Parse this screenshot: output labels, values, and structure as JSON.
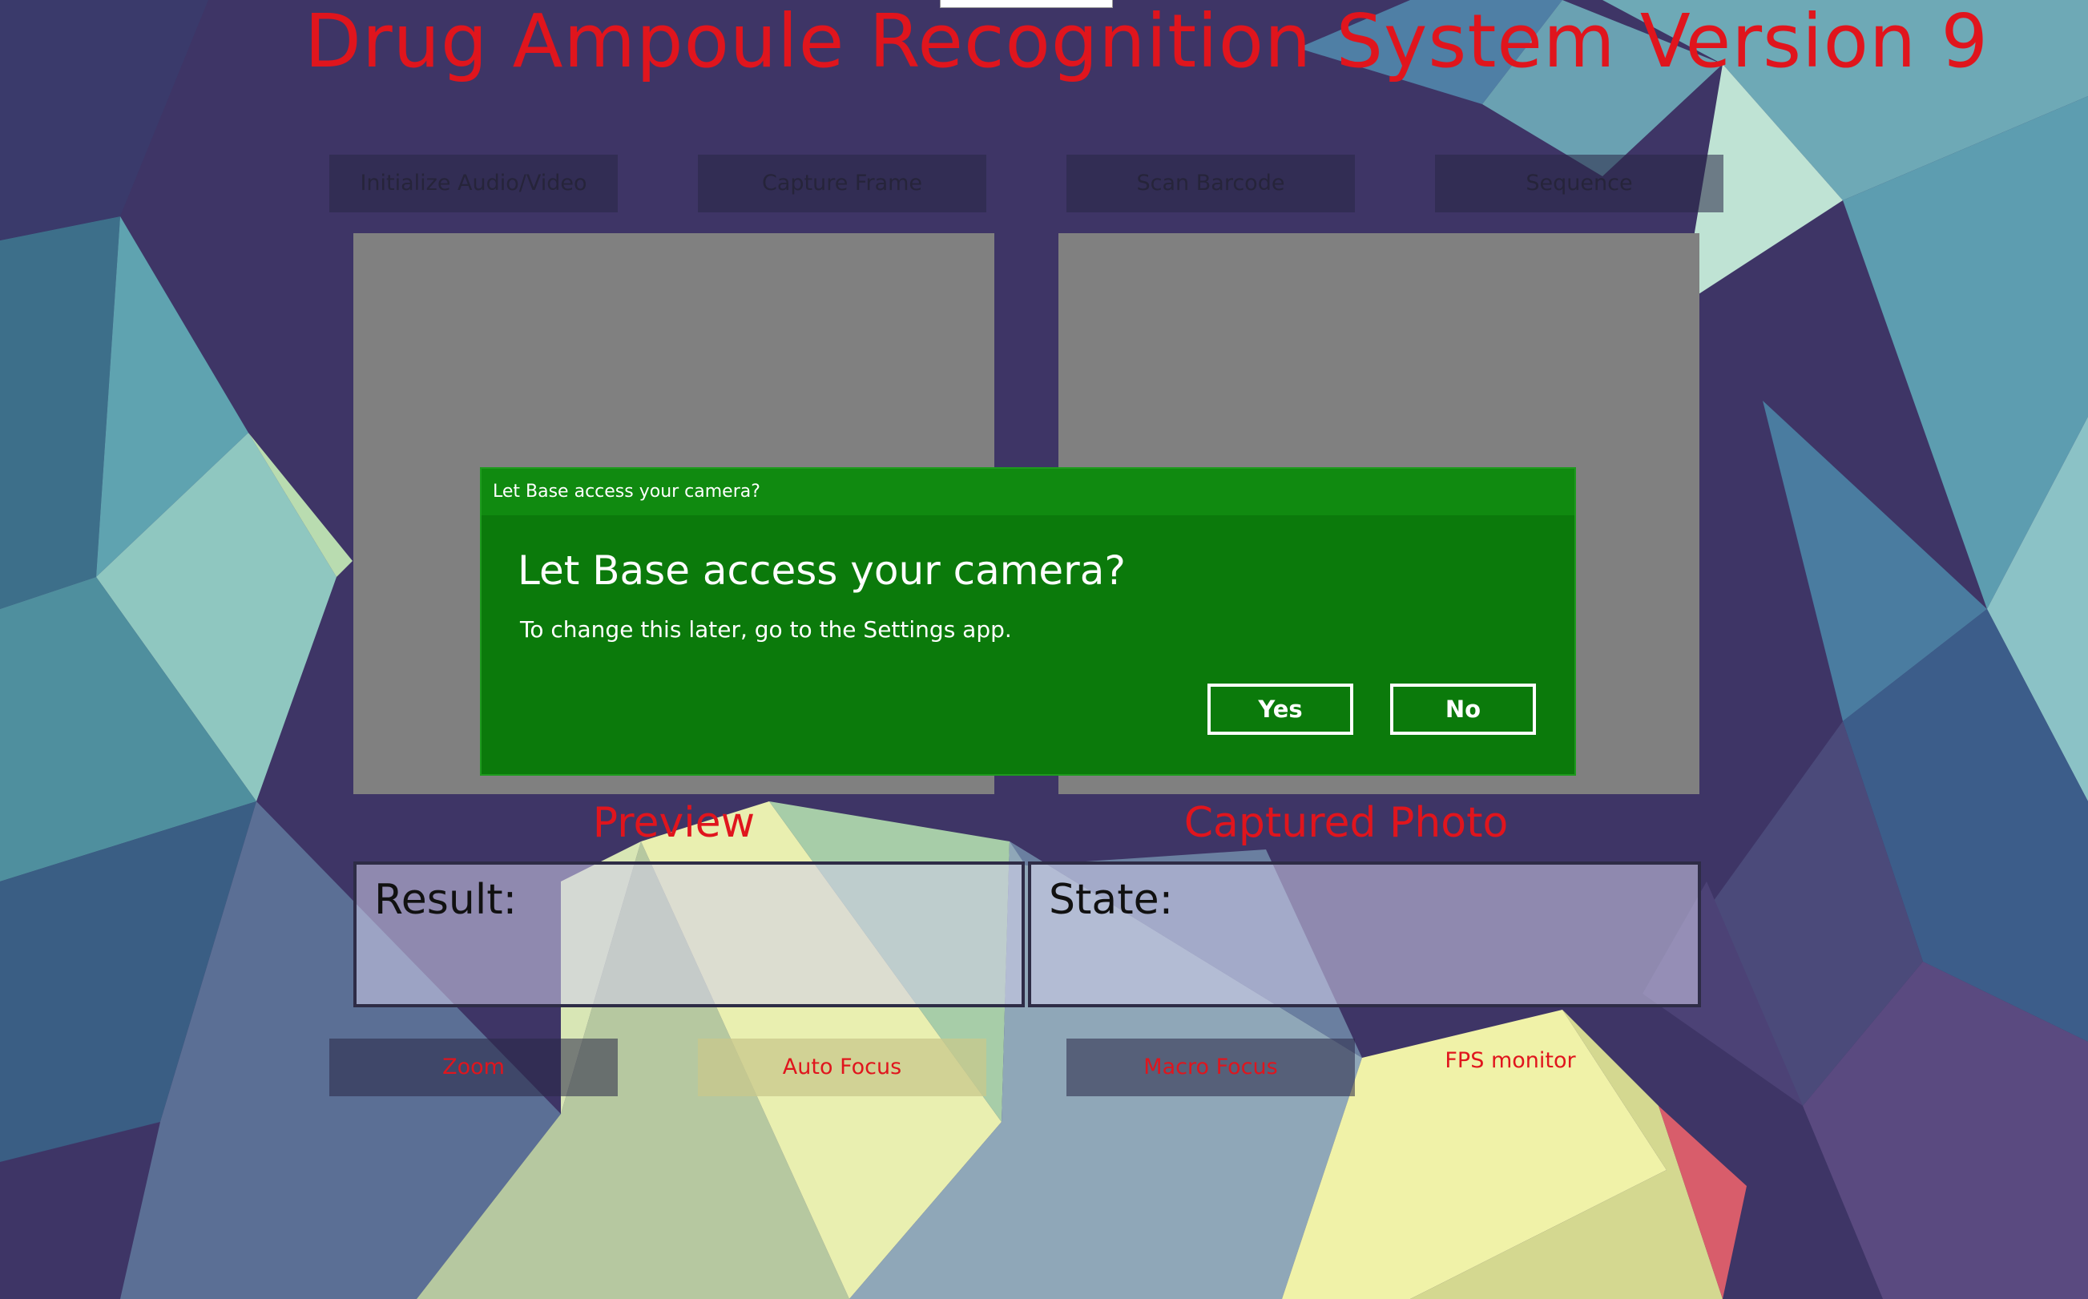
{
  "app": {
    "title": "Drug Ampoule Recognition System Version 9"
  },
  "toolbar": {
    "buttons": [
      {
        "label": "Initialize Audio/Video"
      },
      {
        "label": "Capture Frame"
      },
      {
        "label": "Scan Barcode"
      },
      {
        "label": "Sequence"
      }
    ]
  },
  "panels": {
    "preview_caption": "Preview",
    "captured_caption": "Captured Photo"
  },
  "status": {
    "result_label": "Result:",
    "state_label": "State:"
  },
  "controls": {
    "zoom_label": "Zoom",
    "autofocus_label": "Auto Focus",
    "macrofocus_label": "Macro Focus",
    "fps_label": "FPS monitor"
  },
  "dialog": {
    "titlebar": "Let Base access your camera?",
    "heading": "Let Base access your camera?",
    "body": "To change this later, go to the Settings app.",
    "yes_label": "Yes",
    "no_label": "No"
  },
  "colors": {
    "accent_red": "#e0151d",
    "dialog_green": "#0b7a0b",
    "background": "#3f3566"
  }
}
